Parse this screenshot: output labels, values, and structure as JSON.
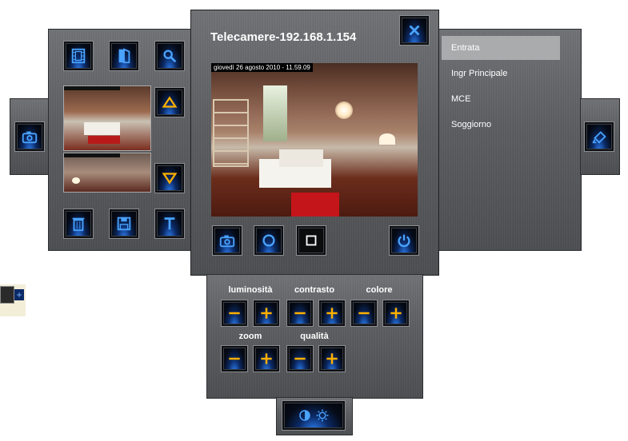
{
  "window": {
    "title": "Telecamere-192.168.1.154",
    "timestamp": "giovedì 26 agosto 2010 - 11.59.09"
  },
  "camera_list": {
    "items": [
      {
        "label": "Entrata",
        "selected": true
      },
      {
        "label": "Ingr Principale",
        "selected": false
      },
      {
        "label": "MCE",
        "selected": false
      },
      {
        "label": "Soggiorno",
        "selected": false
      }
    ]
  },
  "adjustments": {
    "brightness_label": "luminosità",
    "contrast_label": "contrasto",
    "color_label": "colore",
    "zoom_label": "zoom",
    "quality_label": "qualità"
  },
  "icons": {
    "accent": "#ffb000",
    "glow": "#2f86ff",
    "panel": "#5a5c5f"
  }
}
